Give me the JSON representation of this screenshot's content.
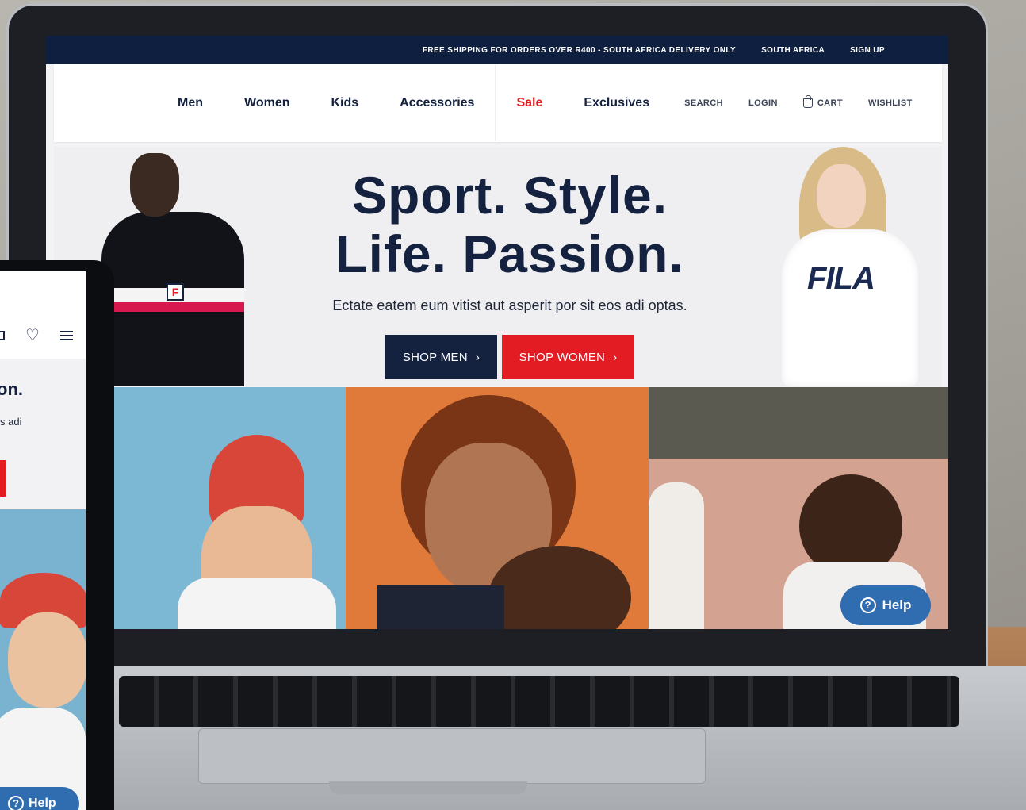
{
  "topbar": {
    "shipping": "FREE SHIPPING FOR ORDERS OVER R400 - SOUTH AFRICA DELIVERY ONLY",
    "region": "SOUTH AFRICA",
    "signup": "SIGN UP"
  },
  "nav": {
    "items": [
      "Men",
      "Women",
      "Kids",
      "Accessories",
      "Sale",
      "Exclusives"
    ],
    "util": {
      "search": "SEARCH",
      "login": "LOGIN",
      "cart": "CART",
      "wishlist": "WISHLIST"
    }
  },
  "hero": {
    "title_line1": "Sport. Style.",
    "title_line2": "Life. Passion.",
    "subtitle": "Ectate eatem eum vitist aut asperit por sit eos adi optas.",
    "shop_men": "SHOP MEN",
    "shop_women": "SHOP WOMEN",
    "chevron": "›",
    "shirt_logo": "FILA"
  },
  "help": {
    "label": "Help",
    "icon": "?"
  },
  "tablet": {
    "title_fragment": "on.",
    "sub_fragment": "s adi",
    "help_label": "Help",
    "heart": "♡"
  },
  "colors": {
    "navy": "#14213f",
    "red": "#e31b23",
    "help_blue": "#2f6db0"
  }
}
